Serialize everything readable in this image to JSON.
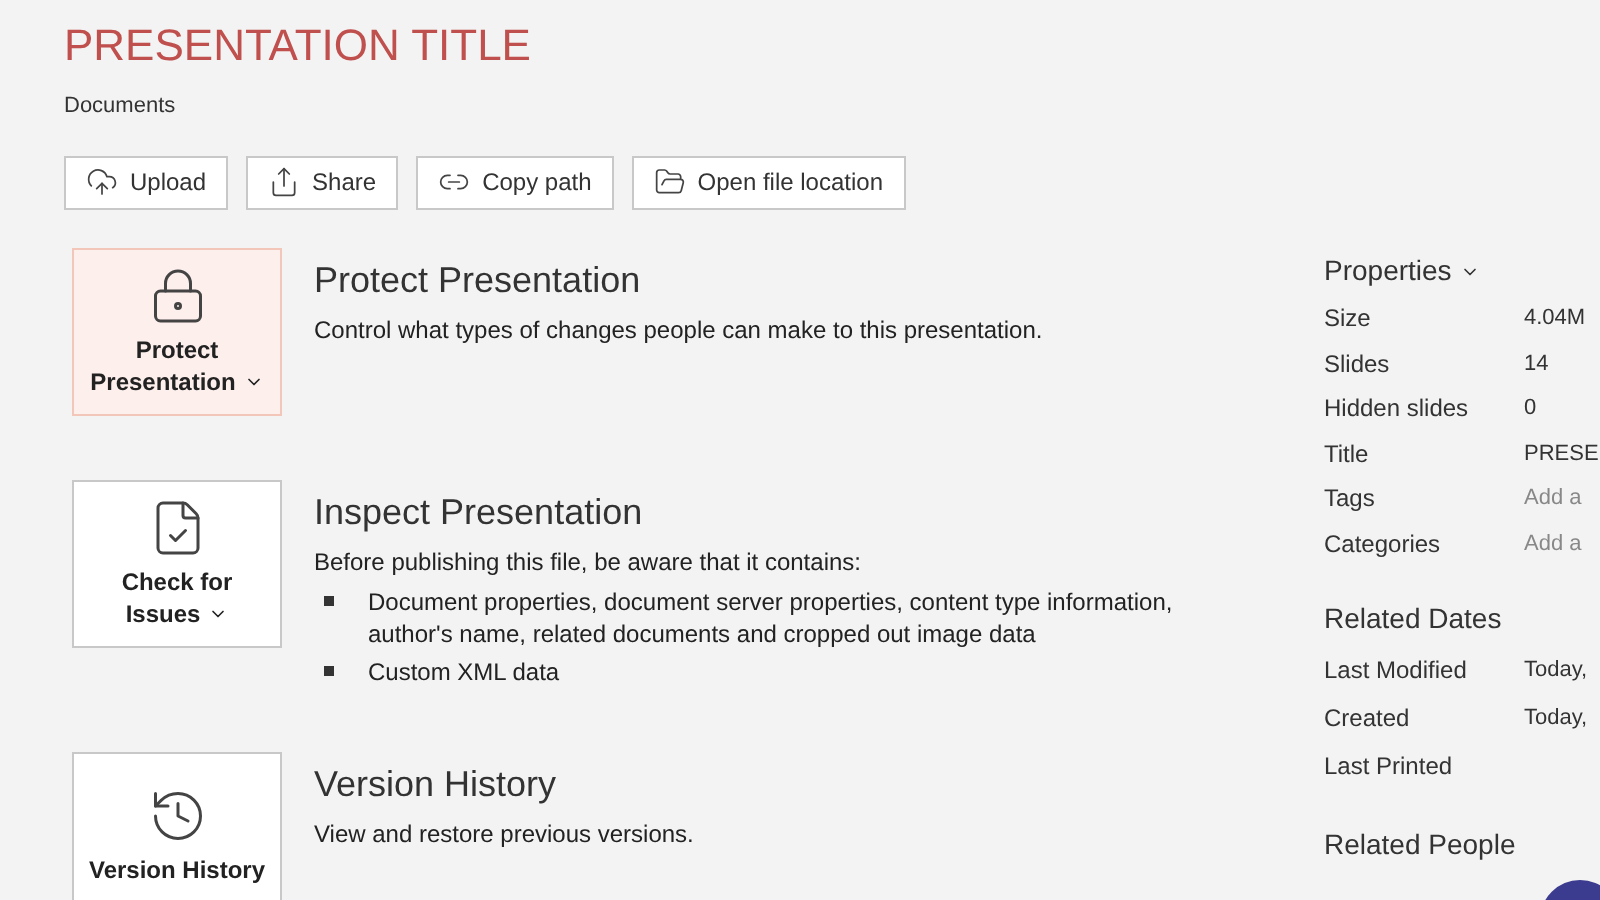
{
  "title": "PRESENTATION TITLE",
  "location": "Documents",
  "actions": [
    {
      "kind": "upload",
      "label": "Upload"
    },
    {
      "kind": "share",
      "label": "Share"
    },
    {
      "kind": "copy",
      "label": "Copy path"
    },
    {
      "kind": "folder",
      "label": "Open file location"
    }
  ],
  "sections": [
    {
      "kind": "protect",
      "button": "Protect Presentation",
      "dropdown": true,
      "highlighted": true,
      "heading": "Protect Presentation",
      "description": "Control what types of changes people can make to this presentation."
    },
    {
      "kind": "inspect",
      "button": "Check for Issues",
      "dropdown": true,
      "highlighted": false,
      "heading": "Inspect Presentation",
      "description": "Before publishing this file, be aware that it contains:",
      "bullets": [
        "Document properties, document server properties, content type information, author's name, related documents and cropped out image data",
        "Custom XML data"
      ]
    },
    {
      "kind": "history",
      "button": "Version History",
      "dropdown": false,
      "highlighted": false,
      "heading": "Version History",
      "description": "View and restore previous versions."
    }
  ],
  "properties": {
    "heading": "Properties",
    "rows": [
      {
        "label": "Size",
        "value": "4.04M",
        "placeholder": false
      },
      {
        "label": "Slides",
        "value": "14",
        "placeholder": false
      },
      {
        "label": "Hidden slides",
        "value": "0",
        "placeholder": false
      },
      {
        "label": "Title",
        "value": "PRESE",
        "placeholder": false
      },
      {
        "label": "Tags",
        "value": "Add a",
        "placeholder": true
      },
      {
        "label": "Categories",
        "value": "Add a",
        "placeholder": true
      }
    ]
  },
  "related_dates": {
    "heading": "Related Dates",
    "rows": [
      {
        "label": "Last Modified",
        "value": "Today,"
      },
      {
        "label": "Created",
        "value": "Today,"
      },
      {
        "label": "Last Printed"
      }
    ]
  },
  "related_people": {
    "heading": "Related People"
  }
}
